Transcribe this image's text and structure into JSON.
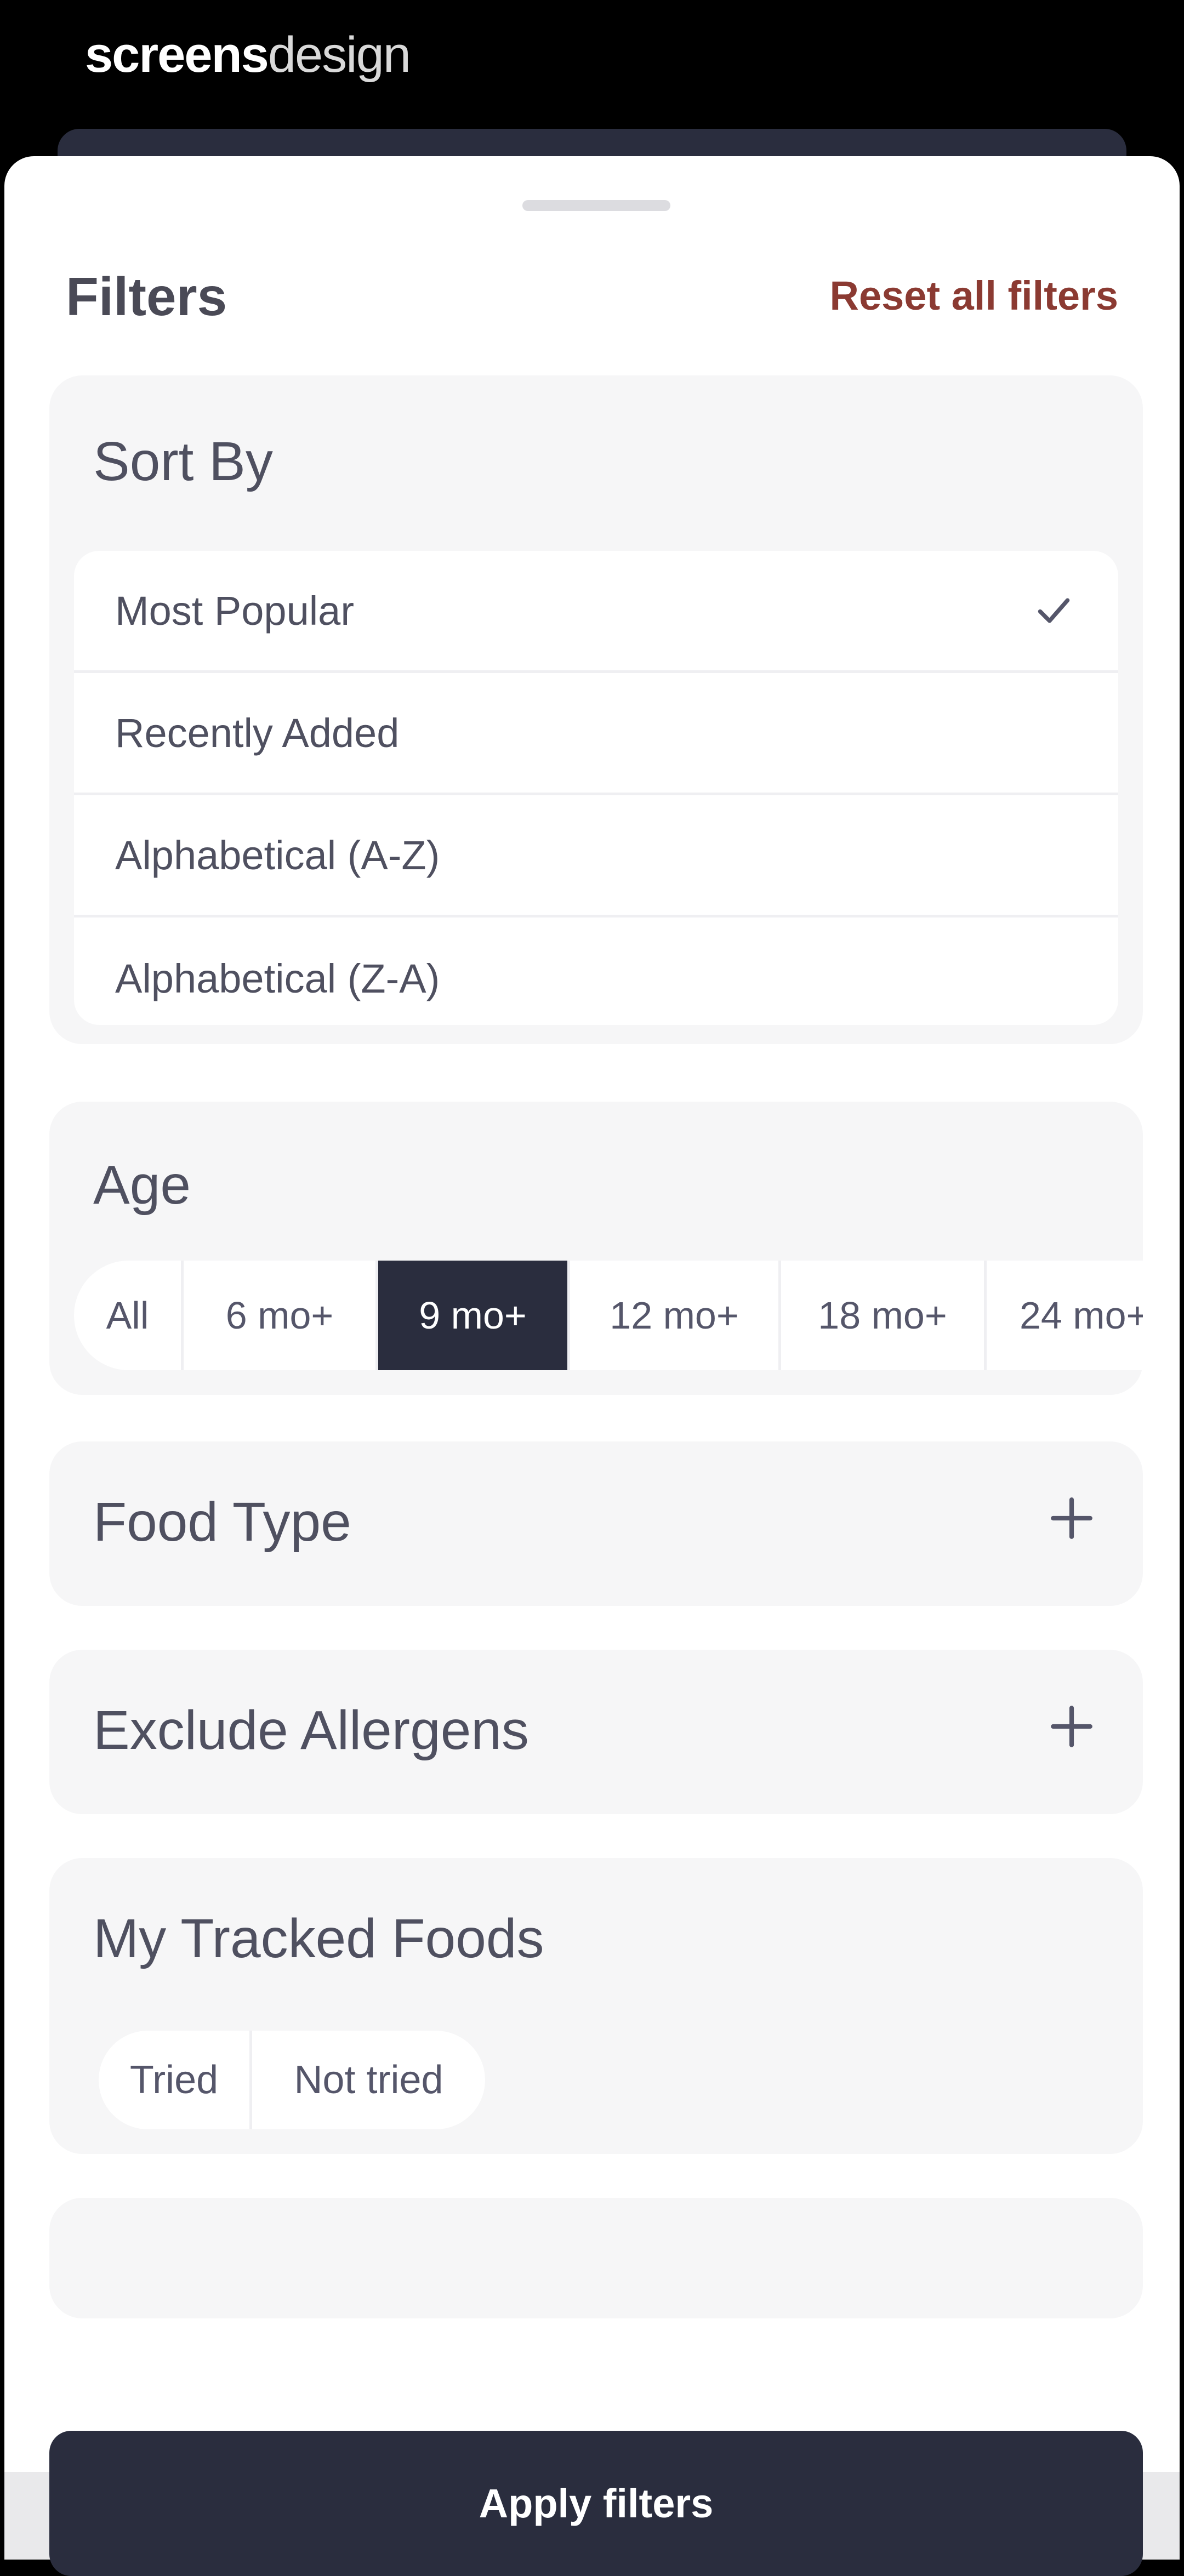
{
  "brand": {
    "part1": "screens",
    "part2": "design"
  },
  "header": {
    "title": "Filters",
    "reset_label": "Reset all filters"
  },
  "sort": {
    "title": "Sort By",
    "options": [
      {
        "label": "Most Popular",
        "selected": true
      },
      {
        "label": "Recently Added",
        "selected": false
      },
      {
        "label": "Alphabetical (A-Z)",
        "selected": false
      },
      {
        "label": "Alphabetical (Z-A)",
        "selected": false
      }
    ]
  },
  "age": {
    "title": "Age",
    "options": [
      {
        "label": "All",
        "selected": false
      },
      {
        "label": "6 mo+",
        "selected": false
      },
      {
        "label": "9 mo+",
        "selected": true
      },
      {
        "label": "12 mo+",
        "selected": false
      },
      {
        "label": "18 mo+",
        "selected": false
      },
      {
        "label": "24 mo+",
        "selected": false
      }
    ]
  },
  "food_type": {
    "title": "Food Type",
    "expand_icon": "plus-icon"
  },
  "allergens": {
    "title": "Exclude Allergens",
    "expand_icon": "plus-icon"
  },
  "tracked": {
    "title": "My Tracked Foods",
    "options": [
      {
        "label": "Tried"
      },
      {
        "label": "Not tried"
      }
    ]
  },
  "footer": {
    "apply_label": "Apply filters"
  },
  "colors": {
    "accent": "#2a2d3e",
    "reset": "#8b3a32",
    "card_bg": "#f6f6f7"
  }
}
